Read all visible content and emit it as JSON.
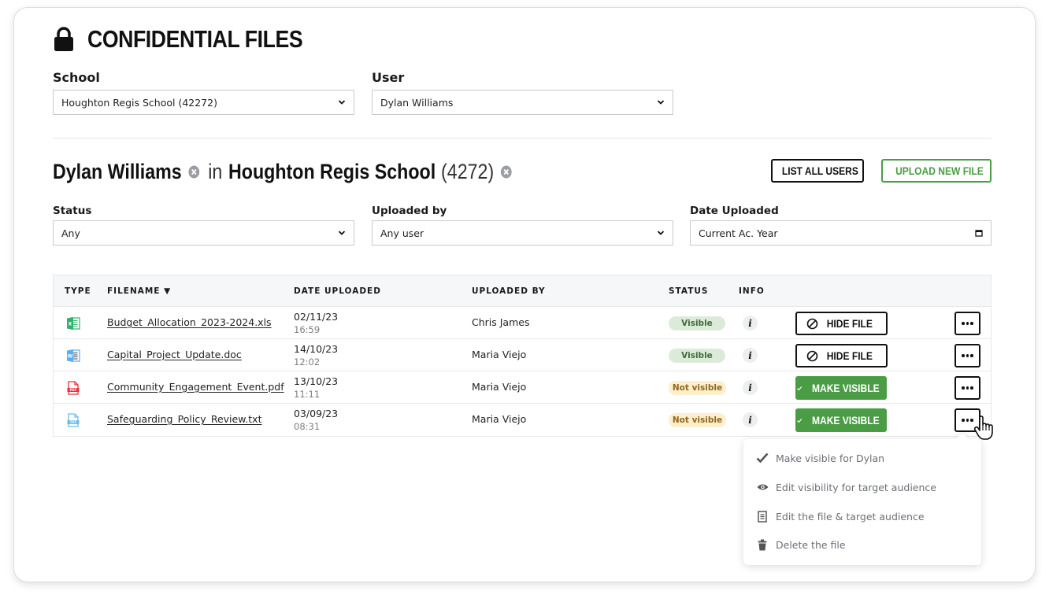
{
  "page": {
    "title": "CONFIDENTIAL FILES",
    "title_icon": "lock-icon"
  },
  "filters_top": {
    "school": {
      "label": "School",
      "value": "Houghton Regis School (42272)"
    },
    "user": {
      "label": "User",
      "value": "Dylan Williams"
    }
  },
  "context": {
    "user_name": "Dylan Williams",
    "connector": "in",
    "school_name": "Houghton Regis School",
    "school_code": "(4272)"
  },
  "actions": {
    "list_all_users": "LIST ALL USERS",
    "upload_new_file": "UPLOAD NEW FILE"
  },
  "filters": {
    "status": {
      "label": "Status",
      "value": "Any"
    },
    "uploaded_by": {
      "label": "Uploaded by",
      "value": "Any user"
    },
    "date_uploaded": {
      "label": "Date Uploaded",
      "value": "Current Ac. Year"
    }
  },
  "table": {
    "columns": [
      "TYPE",
      "FILENAME ▼",
      "DATE UPLOADED",
      "UPLOADED BY",
      "STATUS",
      "INFO"
    ],
    "rows": [
      {
        "type": "xls",
        "filename": "Budget_Allocation_2023-2024.xls",
        "date": "02/11/23",
        "time": "16:59",
        "uploaded_by": "Chris James",
        "status": "Visible",
        "action": "HIDE FILE"
      },
      {
        "type": "doc",
        "filename": "Capital_Project_Update.doc",
        "date": "14/10/23",
        "time": "12:02",
        "uploaded_by": "Maria Viejo",
        "status": "Visible",
        "action": "HIDE FILE"
      },
      {
        "type": "pdf",
        "filename": "Community_Engagement_Event.pdf",
        "date": "13/10/23",
        "time": "11:11",
        "uploaded_by": "Maria Viejo",
        "status": "Not visible",
        "action": "MAKE VISIBLE"
      },
      {
        "type": "txt",
        "filename": "Safeguarding_Policy_Review.txt",
        "date": "03/09/23",
        "time": "08:31",
        "uploaded_by": "Maria Viejo",
        "status": "Not visible",
        "action": "MAKE VISIBLE"
      }
    ],
    "info_glyph": "i"
  },
  "context_menu": {
    "items": [
      {
        "icon": "check-icon",
        "label": "Make visible for Dylan"
      },
      {
        "icon": "eye-icon",
        "label": "Edit visibility for target audience"
      },
      {
        "icon": "document-icon",
        "label": "Edit the file & target audience"
      },
      {
        "icon": "trash-icon",
        "label": "Delete the file"
      }
    ]
  },
  "colors": {
    "accent_green": "#4a9d45",
    "visible_badge_bg": "#dcebd9",
    "visible_badge_text": "#3f6b3b",
    "notvisible_badge_bg": "#fcefcc",
    "notvisible_badge_text": "#94661d"
  }
}
